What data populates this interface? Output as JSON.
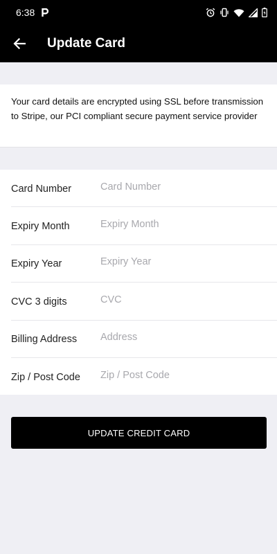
{
  "status_bar": {
    "time": "6:38",
    "left_icons": [
      "parking-icon"
    ],
    "right_icons": [
      "alarm-icon",
      "vibrate-icon",
      "wifi-icon",
      "signal-icon",
      "battery-icon"
    ]
  },
  "app_bar": {
    "back_icon": "arrow-left-icon",
    "title": "Update Card"
  },
  "notice": {
    "text": "Your card details are encrypted using SSL before transmission to Stripe, our PCI compliant secure payment service provider"
  },
  "form": {
    "fields": [
      {
        "label": "Card Number",
        "placeholder": "Card Number",
        "value": ""
      },
      {
        "label": "Expiry Month",
        "placeholder": "Expiry Month",
        "value": ""
      },
      {
        "label": "Expiry Year",
        "placeholder": "Expiry Year",
        "value": ""
      },
      {
        "label": "CVC 3 digits",
        "placeholder": "CVC",
        "value": ""
      },
      {
        "label": "Billing Address",
        "placeholder": "Address",
        "value": ""
      },
      {
        "label": "Zip / Post Code",
        "placeholder": "Zip / Post Code",
        "value": ""
      }
    ]
  },
  "submit": {
    "label": "UPDATE CREDIT CARD"
  },
  "colors": {
    "bar_background": "#000000",
    "page_background": "#efeff4",
    "placeholder": "#a8a8ad"
  }
}
